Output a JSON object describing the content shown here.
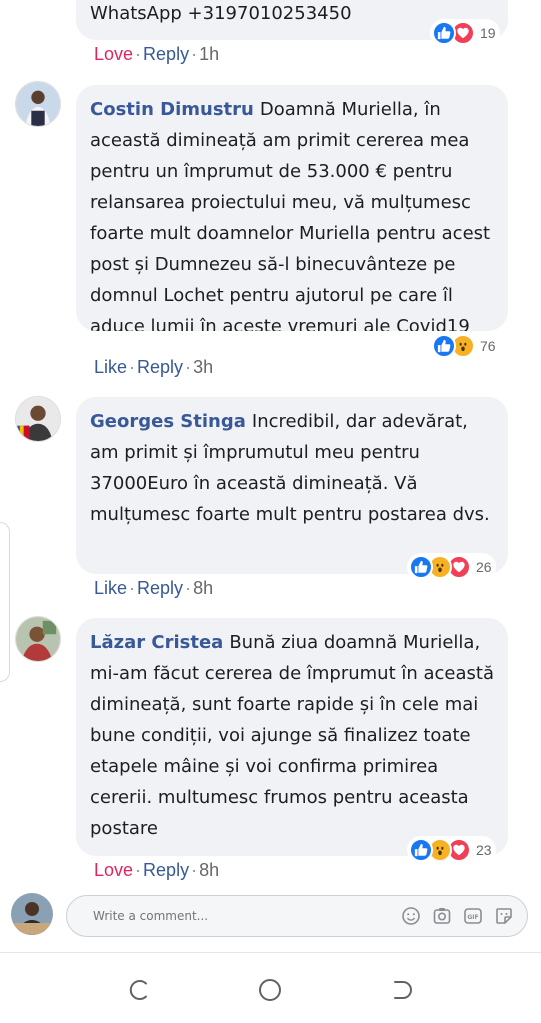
{
  "comments": [
    {
      "text": "WhatsApp +3197010253450",
      "reaction_label": "Love",
      "reply_label": "Reply",
      "time": "1h",
      "reactions": [
        "like-icon",
        "love-icon"
      ],
      "reaction_count": "19"
    },
    {
      "author": "Costin Dimustru",
      "text": "Doamnă Muriella, în această dimineață am primit cererea mea pentru un împrumut de 53.000 € pentru relansarea proiectului meu, vă mulțumesc foarte mult doamnelor Muriella pentru acest post și Dumnezeu să-l binecuvânteze pe domnul Lochet pentru ajutorul pe care îl aduce lumii în aceste vremuri ale Covid19",
      "reaction_label": "Like",
      "reply_label": "Reply",
      "time": "3h",
      "reactions": [
        "like-icon",
        "wow-icon"
      ],
      "reaction_count": "76"
    },
    {
      "author": "Georges Stinga",
      "text": "Incredibil, dar adevărat, am primit și împrumutul meu pentru 37000Euro în această dimineață. Vă mulțumesc foarte mult pentru postarea dvs.",
      "reaction_label": "Like",
      "reply_label": "Reply",
      "time": "8h",
      "reactions": [
        "like-icon",
        "wow-icon",
        "love-icon"
      ],
      "reaction_count": "26"
    },
    {
      "author": "Lăzar Cristea",
      "text": "Bună ziua doamnă Muriella, mi-am făcut cererea de împrumut în această dimineață, sunt foarte rapide și în cele mai bune condiții, voi ajunge să finalizez toate etapele mâine și voi confirma primirea cererii. multumesc frumos pentru aceasta postare",
      "reaction_label": "Love",
      "reply_label": "Reply",
      "time": "8h",
      "reactions": [
        "like-icon",
        "wow-icon",
        "love-icon"
      ],
      "reaction_count": "23"
    }
  ],
  "composer": {
    "placeholder": "Write a comment...",
    "icons": [
      "emoji-icon",
      "camera-icon",
      "gif-icon",
      "sticker-icon"
    ]
  },
  "navbar": {
    "icons": [
      "recent-apps-icon",
      "home-icon",
      "back-icon"
    ]
  },
  "colors": {
    "author_link": "#385898",
    "love_action": "#e0245e",
    "bubble_bg": "#f0f2f5",
    "like_blue": "#1877f2",
    "wow_yellow": "#f7b125",
    "love_red": "#f33e58"
  }
}
